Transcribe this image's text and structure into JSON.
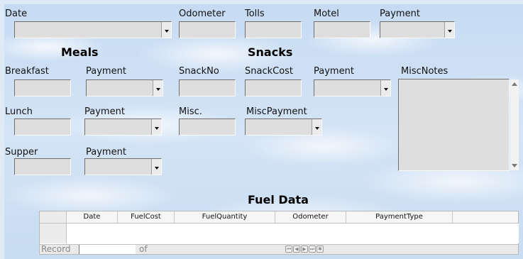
{
  "labels": {
    "date": "Date",
    "odometer": "Odometer",
    "tolls": "Tolls",
    "motel": "Motel",
    "payment_top": "Payment",
    "breakfast": "Breakfast",
    "breakfast_payment": "Payment",
    "snackno": "SnackNo",
    "snackcost": "SnackCost",
    "snack_payment": "Payment",
    "miscnotes": "MiscNotes",
    "lunch": "Lunch",
    "lunch_payment": "Payment",
    "misc": "Misc.",
    "miscpayment": "MiscPayment",
    "supper": "Supper",
    "supper_payment": "Payment"
  },
  "headings": {
    "meals": "Meals",
    "snacks": "Snacks",
    "fuel": "Fuel Data"
  },
  "grid": {
    "columns": [
      "Date",
      "FuelCost",
      "FuelQuantity",
      "Odometer",
      "PaymentType"
    ],
    "nav_record": "Record",
    "nav_of": "of",
    "nav_buttons": [
      "first",
      "prev",
      "next",
      "last",
      "new"
    ]
  }
}
